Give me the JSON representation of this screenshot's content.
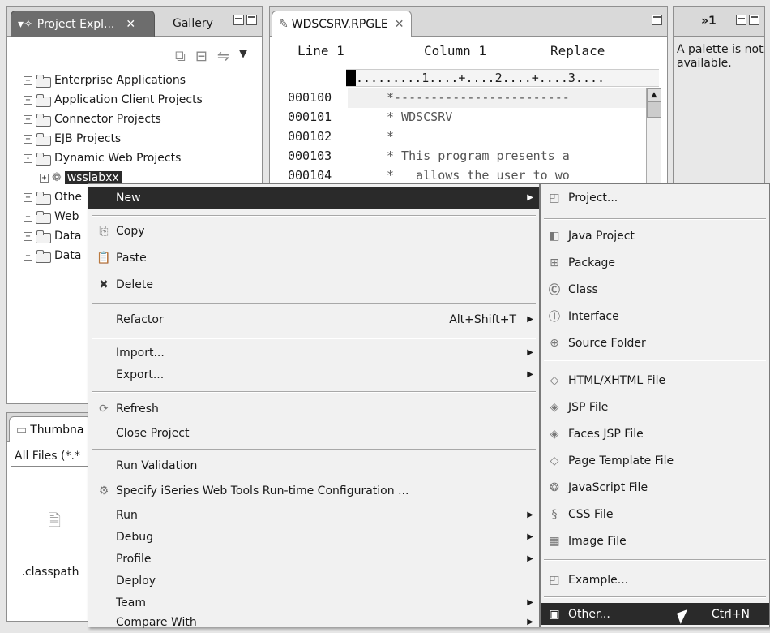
{
  "explorer": {
    "tab_label": "Project Expl...",
    "gallery_tab": "Gallery",
    "tree": [
      {
        "label": "Enterprise Applications",
        "expander": "+"
      },
      {
        "label": "Application Client Projects",
        "expander": "+"
      },
      {
        "label": "Connector Projects",
        "expander": "+"
      },
      {
        "label": "EJB Projects",
        "expander": "+"
      },
      {
        "label": "Dynamic Web Projects",
        "expander": "-"
      },
      {
        "label": "wsslabxx",
        "expander": "+"
      },
      {
        "label": "Othe",
        "expander": "+"
      },
      {
        "label": "Web",
        "expander": "+"
      },
      {
        "label": "Data",
        "expander": "+"
      },
      {
        "label": "Data",
        "expander": "+"
      }
    ]
  },
  "thumbnail": {
    "tab_label": "Thumbna",
    "filter_value": "All Files (*.*",
    "file_label": ".classpath"
  },
  "editor": {
    "tab_label": "WDSCSRV.RPGLE",
    "line_label": "Line 1",
    "column_label": "Column 1",
    "mode_label": "Replace",
    "ruler": ".........1....+....2....+....3....",
    "lines": [
      {
        "seq": "000100",
        "code": "*------------------------"
      },
      {
        "seq": "000101",
        "code": "* WDSCSRV"
      },
      {
        "seq": "000102",
        "code": "*"
      },
      {
        "seq": "000103",
        "code": "* This program presents a"
      },
      {
        "seq": "000104",
        "code": "*   allows the user to wo"
      }
    ]
  },
  "palette": {
    "overflow_label": "»1",
    "message": "A palette is not available."
  },
  "context_menu": {
    "new": "New",
    "copy": "Copy",
    "paste": "Paste",
    "delete": "Delete",
    "refactor": "Refactor",
    "refactor_accel": "Alt+Shift+T",
    "import": "Import...",
    "export": "Export...",
    "refresh": "Refresh",
    "close_project": "Close Project",
    "run_validation": "Run Validation",
    "specify": "Specify iSeries Web Tools Run-time Configuration ...",
    "run": "Run",
    "debug": "Debug",
    "profile": "Profile",
    "deploy": "Deploy",
    "team": "Team",
    "compare_with": "Compare With"
  },
  "submenu": {
    "project": "Project...",
    "java_project": "Java Project",
    "package": "Package",
    "class": "Class",
    "interface": "Interface",
    "source_folder": "Source Folder",
    "html_file": "HTML/XHTML File",
    "jsp_file": "JSP File",
    "faces_jsp_file": "Faces JSP File",
    "page_template_file": "Page Template File",
    "javascript_file": "JavaScript File",
    "css_file": "CSS File",
    "image_file": "Image File",
    "example": "Example...",
    "other": "Other...",
    "other_accel": "Ctrl+N"
  }
}
